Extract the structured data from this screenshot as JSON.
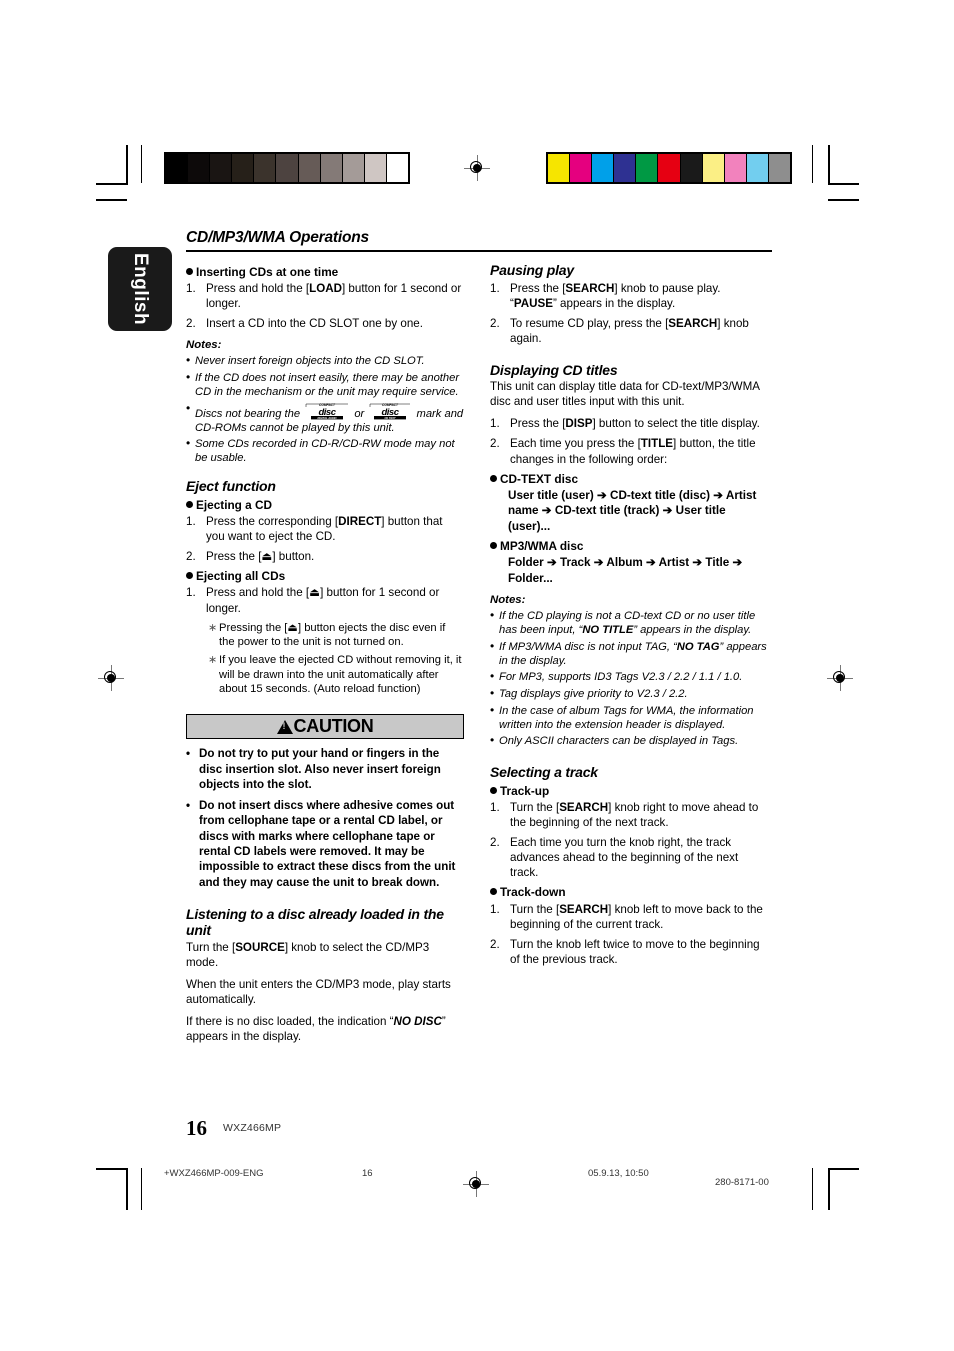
{
  "document": {
    "heading": "CD/MP3/WMA Operations",
    "language_tab": "English",
    "page_number": "16",
    "model": "WXZ466MP"
  },
  "production_footer": {
    "file": "+WXZ466MP-009-ENG",
    "page": "16",
    "date": "05.9.13, 10:50",
    "code": "280-8171-00"
  },
  "calibration": {
    "gray_bar": [
      "#000000",
      "#0d0a0a",
      "#1a1513",
      "#262019",
      "#3b332c",
      "#4d4340",
      "#665b57",
      "#847a77",
      "#a49b98",
      "#cfc6c3",
      "#ffffff"
    ],
    "color_bar": [
      "#f6e500",
      "#e5007f",
      "#00a0e9",
      "#2e3192",
      "#009944",
      "#e60012",
      "#1a1a1a",
      "#fbef85",
      "#f282bd",
      "#72ceef",
      "#8e8e8e"
    ]
  },
  "left_column": {
    "inserting": {
      "title": "Inserting CDs at one time",
      "steps": [
        {
          "num": "1.",
          "parts": [
            {
              "t": "Press and hold the ["
            },
            {
              "t": "LOAD",
              "s": "b"
            },
            {
              "t": "] button for 1 second or longer."
            }
          ]
        },
        {
          "num": "2.",
          "parts": [
            {
              "t": "Insert a CD into the CD SLOT one by one."
            }
          ]
        }
      ]
    },
    "notes_title": "Notes:",
    "notes": [
      {
        "parts": [
          {
            "t": "Never insert foreign objects into the CD SLOT."
          }
        ]
      },
      {
        "parts": [
          {
            "t": "If the CD does not insert easily, there may be another CD in the mechanism or the unit may require service."
          }
        ]
      },
      {
        "parts": [
          {
            "t": "Discs not bearing the "
          },
          {
            "t": "",
            "s": "logo-audio"
          },
          {
            "t": " or "
          },
          {
            "t": "",
            "s": "logo-text"
          },
          {
            "t": " mark and CD-ROMs cannot  be played by this unit."
          }
        ]
      },
      {
        "parts": [
          {
            "t": "Some CDs recorded in CD-R/CD-RW mode may not be usable."
          }
        ]
      }
    ],
    "eject": {
      "title": "Eject function",
      "sub_a": "Ejecting a CD",
      "steps_a": [
        {
          "num": "1.",
          "parts": [
            {
              "t": "Press the corresponding ["
            },
            {
              "t": "DIRECT",
              "s": "b"
            },
            {
              "t": "] button that you want to eject the CD."
            }
          ]
        },
        {
          "num": "2.",
          "parts": [
            {
              "t": "Press the [⏏] button."
            }
          ]
        }
      ],
      "sub_b": "Ejecting all CDs",
      "steps_b": [
        {
          "num": "1.",
          "parts": [
            {
              "t": "Press and hold the [⏏] button for 1 second or longer."
            }
          ]
        }
      ],
      "star_notes": [
        "Pressing the [⏏] button ejects the disc even if the power to the unit is not turned on.",
        "If you leave the ejected CD without removing it, it will be drawn into the unit automatically after about 15 seconds. (Auto reload function)"
      ]
    },
    "caution": {
      "label": "CAUTION",
      "items": [
        "Do not try to put your hand or fingers in the disc insertion slot. Also never insert foreign objects into the slot.",
        "Do not insert discs where adhesive comes out from cellophane tape or a rental CD label, or discs with marks where cellophane tape or rental CD labels were removed. It may be impossible to extract these discs from the unit and they may cause the unit to break down."
      ]
    },
    "listening": {
      "title": "Listening to a disc already loaded in the unit",
      "paragraphs": [
        [
          {
            "t": "Turn the ["
          },
          {
            "t": "SOURCE",
            "s": "b"
          },
          {
            "t": "] knob to select the CD/MP3 mode."
          }
        ],
        [
          {
            "t": "When the unit enters the CD/MP3 mode, play starts automatically."
          }
        ],
        [
          {
            "t": "If there is no disc loaded, the indication “"
          },
          {
            "t": "NO DISC",
            "s": "bi"
          },
          {
            "t": "” appears in the display."
          }
        ]
      ]
    }
  },
  "right_column": {
    "pausing": {
      "title": "Pausing play",
      "steps": [
        {
          "num": "1.",
          "parts": [
            {
              "t": "Press the ["
            },
            {
              "t": "SEARCH",
              "s": "b"
            },
            {
              "t": "] knob to pause play. “"
            },
            {
              "t": "PAUSE",
              "s": "b"
            },
            {
              "t": "” appears in the display."
            }
          ]
        },
        {
          "num": "2.",
          "parts": [
            {
              "t": "To resume CD play, press the ["
            },
            {
              "t": "SEARCH",
              "s": "b"
            },
            {
              "t": "] knob again."
            }
          ]
        }
      ]
    },
    "displaying": {
      "title": "Displaying CD titles",
      "intro": "This unit can display title data for CD-text/MP3/WMA disc and user titles input with this unit.",
      "steps": [
        {
          "num": "1.",
          "parts": [
            {
              "t": "Press the ["
            },
            {
              "t": "DISP",
              "s": "b"
            },
            {
              "t": "] button to select the title display."
            }
          ]
        },
        {
          "num": "2.",
          "parts": [
            {
              "t": "Each time you press the ["
            },
            {
              "t": "TITLE",
              "s": "b"
            },
            {
              "t": "] button, the title changes in the following order:"
            }
          ]
        }
      ],
      "cdtext_sub": "CD-TEXT disc",
      "cdtext_order": "User title (user) ➔ CD-text title (disc) ➔ Artist name ➔ CD-text title (track) ➔ User title (user)...",
      "mp3_sub": "MP3/WMA disc",
      "mp3_order": "Folder ➔ Track ➔ Album ➔ Artist ➔ Title ➔ Folder...",
      "notes_title": "Notes:",
      "notes": [
        {
          "parts": [
            {
              "t": "If the CD playing is not a CD-text CD or no user title has been input, “"
            },
            {
              "t": "NO TITLE",
              "s": "bi"
            },
            {
              "t": "” appears in the display."
            }
          ]
        },
        {
          "parts": [
            {
              "t": "If MP3/WMA disc is not input TAG, “"
            },
            {
              "t": "NO TAG",
              "s": "bi"
            },
            {
              "t": "” appears in the display."
            }
          ]
        },
        {
          "parts": [
            {
              "t": "For MP3, supports ID3 Tags V2.3 / 2.2 / 1.1 / 1.0."
            }
          ]
        },
        {
          "parts": [
            {
              "t": "Tag displays give priority to V2.3 / 2.2."
            }
          ]
        },
        {
          "parts": [
            {
              "t": "In the case of album Tags for WMA, the information written into the extension header is displayed."
            }
          ]
        },
        {
          "parts": [
            {
              "t": "Only ASCII characters can be displayed in Tags."
            }
          ]
        }
      ]
    },
    "selecting": {
      "title": "Selecting a track",
      "sub_up": "Track-up",
      "steps_up": [
        {
          "num": "1.",
          "parts": [
            {
              "t": "Turn the ["
            },
            {
              "t": "SEARCH",
              "s": "b"
            },
            {
              "t": "] knob right to move ahead to the beginning of the next track."
            }
          ]
        },
        {
          "num": "2.",
          "parts": [
            {
              "t": "Each time you turn the knob right, the track advances ahead to the beginning of the next track."
            }
          ]
        }
      ],
      "sub_down": "Track-down",
      "steps_down": [
        {
          "num": "1.",
          "parts": [
            {
              "t": "Turn the ["
            },
            {
              "t": "SEARCH",
              "s": "b"
            },
            {
              "t": "] knob left to move back to the beginning of the current track."
            }
          ]
        },
        {
          "num": "2.",
          "parts": [
            {
              "t": "Turn the knob left twice to move to the beginning of the previous track."
            }
          ]
        }
      ]
    }
  }
}
